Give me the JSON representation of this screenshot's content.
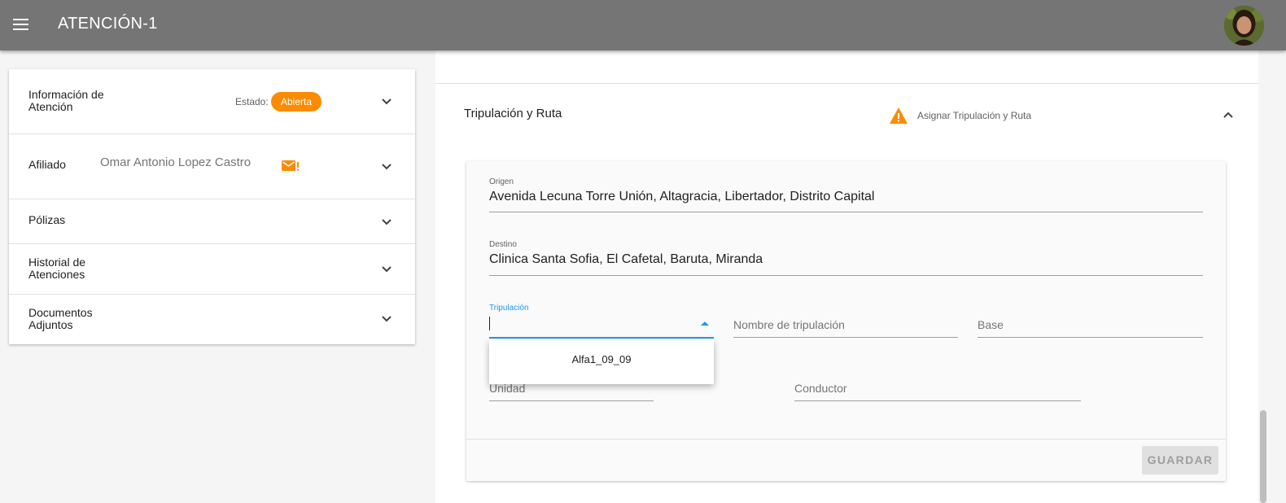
{
  "app": {
    "title": "ATENCIÓN-1"
  },
  "icons": {
    "menu": "menu-icon",
    "avatar": "user-avatar",
    "chevron_down": "chevron-down-icon",
    "chevron_up": "chevron-up-icon",
    "mail": "mail-alert-icon",
    "warning": "warning-icon"
  },
  "colors": {
    "appbar": "#757575",
    "badge": "#fb8c00",
    "warning": "#fb8c00",
    "focus": "#2196f3"
  },
  "left_panel": {
    "info": {
      "title": "Información de Atención",
      "estado_label": "Estado:",
      "estado_value": "Abierta"
    },
    "afiliado": {
      "title": "Afiliado",
      "name": "Omar Antonio Lopez Castro"
    },
    "polizas": {
      "title": "Pólizas"
    },
    "historial": {
      "title": "Historial de Atenciones"
    },
    "documentos": {
      "title": "Documentos Adjuntos"
    }
  },
  "right_panel": {
    "section_title": "Tripulación y Ruta",
    "warning_text": "Asignar Tripulación y Ruta",
    "origen": {
      "label": "Origen",
      "value": "Avenida Lecuna Torre Unión, Altagracia, Libertador, Distrito Capital"
    },
    "destino": {
      "label": "Destino",
      "value": "Clinica Santa Sofia, El Cafetal, Baruta, Miranda"
    },
    "tripulacion": {
      "label": "Tripulación",
      "value": ""
    },
    "nombre_tripulacion": {
      "placeholder": "Nombre de tripulación"
    },
    "base": {
      "placeholder": "Base"
    },
    "unidad": {
      "placeholder": "Unidad"
    },
    "conductor": {
      "placeholder": "Conductor"
    },
    "save_label": "GUARDAR",
    "dropdown_options": [
      "Alfa1_09_09"
    ]
  }
}
